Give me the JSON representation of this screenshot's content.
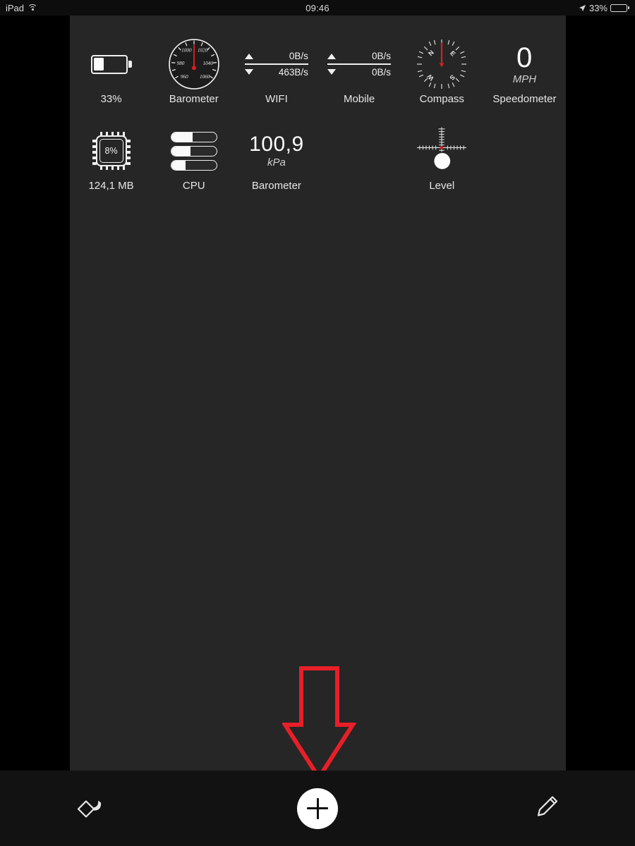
{
  "statusbar": {
    "device": "iPad",
    "wifi_icon": "wifi-icon",
    "time": "09:46",
    "location_icon": "location-arrow-icon",
    "battery_percent": "33%",
    "battery_level": 33
  },
  "widgets": {
    "row1": [
      {
        "id": "battery",
        "type": "battery",
        "label": "33%",
        "fill_percent": 33
      },
      {
        "id": "barometer-dial",
        "type": "gauge",
        "label": "Barometer",
        "ticks": [
          "960",
          "980",
          "1000",
          "1020",
          "1040",
          "1060"
        ],
        "needle_color": "#d12020",
        "needle_angle_deg": 0
      },
      {
        "id": "wifi",
        "type": "network",
        "label": "WIFI",
        "up": "0B/s",
        "down": "463B/s"
      },
      {
        "id": "mobile",
        "type": "network",
        "label": "Mobile",
        "up": "0B/s",
        "down": "0B/s"
      },
      {
        "id": "compass",
        "type": "compass",
        "label": "Compass",
        "cardinals": [
          "N",
          "E",
          "S",
          "W"
        ],
        "needle_color": "#d12020",
        "heading_deg": 0
      },
      {
        "id": "speedometer",
        "type": "value",
        "label": "Speedometer",
        "value": "0",
        "unit": "MPH"
      }
    ],
    "row2": [
      {
        "id": "memory",
        "type": "chip",
        "label": "124,1 MB",
        "value": "8%"
      },
      {
        "id": "cpu",
        "type": "bars",
        "label": "CPU",
        "bars": [
          48,
          42,
          32
        ]
      },
      {
        "id": "barometer-value",
        "type": "value",
        "label": "Barometer",
        "value": "100,9",
        "unit": "kPa"
      },
      {
        "id": "placeholder",
        "type": "empty",
        "label": ""
      },
      {
        "id": "level",
        "type": "level",
        "label": "Level",
        "center_color": "#c62828",
        "bubble_color": "#ffffff"
      },
      {
        "id": "placeholder2",
        "type": "empty",
        "label": ""
      }
    ]
  },
  "annotation": {
    "arrow_icon": "down-arrow-annotation",
    "color": "#e81f28"
  },
  "toolbar": {
    "theme_icon": "paint-bucket-icon",
    "add_icon": "plus-icon",
    "edit_icon": "pencil-icon"
  },
  "colors": {
    "background": "#000000",
    "panel": "#262626",
    "toolbar": "#121212",
    "accent_red": "#d12020",
    "text": "#e9e9e9"
  }
}
